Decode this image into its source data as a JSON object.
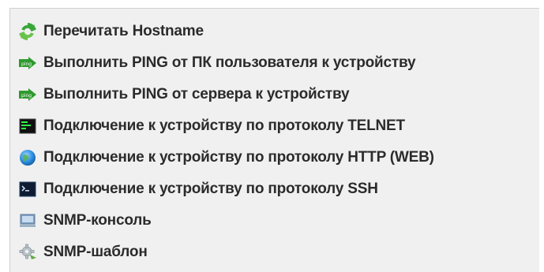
{
  "menu": {
    "items": [
      {
        "label": "Перечитать Hostname",
        "icon": "refresh-icon"
      },
      {
        "label": "Выполнить PING от ПК пользователя к устройству",
        "icon": "ping-icon"
      },
      {
        "label": "Выполнить PING от сервера к устройству",
        "icon": "ping-icon"
      },
      {
        "label": "Подключение к устройству по протоколу TELNET",
        "icon": "terminal-icon"
      },
      {
        "label": "Подключение к устройству по протоколу HTTP (WEB)",
        "icon": "globe-icon"
      },
      {
        "label": "Подключение к устройству по протоколу SSH",
        "icon": "ssh-terminal-icon"
      },
      {
        "label": "SNMP-консоль",
        "icon": "computer-icon"
      },
      {
        "label": "SNMP-шаблон",
        "icon": "gear-icon"
      }
    ]
  },
  "colors": {
    "menu_background": "#f0f0f0",
    "text": "#2b2b2b",
    "refresh_green": "#3aa63a",
    "ping_green": "#2f9a2f",
    "terminal_green": "#2cff4a",
    "globe_blue": "#2b8de0"
  }
}
